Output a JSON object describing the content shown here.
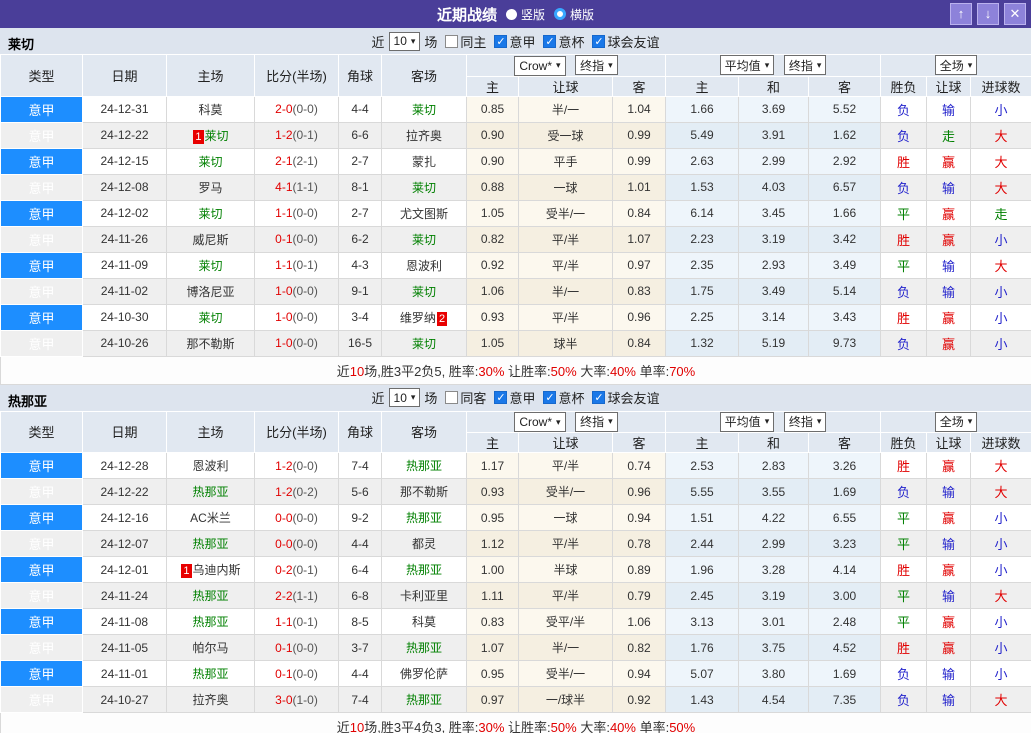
{
  "titlebar": {
    "title": "近期战绩",
    "radio_vertical": "竖版",
    "radio_horizontal": "横版",
    "buttons": {
      "up": "↑",
      "down": "↓",
      "close": "✕"
    }
  },
  "controls": {
    "near": "近",
    "matches": "场"
  },
  "header": {
    "col_type": "类型",
    "col_date": "日期",
    "col_home": "主场",
    "col_score": "比分(半场)",
    "col_corner": "角球",
    "col_away": "客场",
    "crown_select": "Crow*",
    "final_select": "终指",
    "avg_select": "平均值",
    "full_select": "全场",
    "sub_home": "主",
    "sub_handicap": "让球",
    "sub_away": "客",
    "sub_draw": "和",
    "col_result": "胜负",
    "col_asian": "让球",
    "col_goals": "进球数"
  },
  "colors": {
    "titlebar_bg": "#4a3e99",
    "league_cell": "#1d8eff",
    "win_red": "#e10000",
    "draw_green": "#008000",
    "lose_blue": "#2323cc",
    "self_team_green": "#008000",
    "badge_red": "#e80000",
    "checked_blue": "#1a78e8"
  },
  "sections": [
    {
      "team": "莱切",
      "count": "10",
      "filters": [
        {
          "label": "同主",
          "checked": false
        },
        {
          "label": "意甲",
          "checked": true
        },
        {
          "label": "意杯",
          "checked": true
        },
        {
          "label": "球会友谊",
          "checked": true
        }
      ],
      "rows": [
        {
          "lg": "意甲",
          "dt": "24-12-31",
          "hb": "",
          "hm": "科莫",
          "hs": false,
          "ft": "2-0",
          "ht": "(0-0)",
          "cn": "4-4",
          "ab": "",
          "aw": "莱切",
          "as": true,
          "ch": "0.85",
          "cp": "半/一",
          "ca": "1.04",
          "eh": "1.66",
          "ed": "3.69",
          "ea": "5.52",
          "rs": "负",
          "hc": "输",
          "gl": "小"
        },
        {
          "lg": "意甲",
          "dt": "24-12-22",
          "hb": "1",
          "hm": "莱切",
          "hs": true,
          "ft": "1-2",
          "ht": "(0-1)",
          "cn": "6-6",
          "ab": "",
          "aw": "拉齐奥",
          "as": false,
          "ch": "0.90",
          "cp": "受一球",
          "ca": "0.99",
          "eh": "5.49",
          "ed": "3.91",
          "ea": "1.62",
          "rs": "负",
          "hc": "走",
          "gl": "大"
        },
        {
          "lg": "意甲",
          "dt": "24-12-15",
          "hb": "",
          "hm": "莱切",
          "hs": true,
          "ft": "2-1",
          "ht": "(2-1)",
          "cn": "2-7",
          "ab": "",
          "aw": "蒙扎",
          "as": false,
          "ch": "0.90",
          "cp": "平手",
          "ca": "0.99",
          "eh": "2.63",
          "ed": "2.99",
          "ea": "2.92",
          "rs": "胜",
          "hc": "赢",
          "gl": "大"
        },
        {
          "lg": "意甲",
          "dt": "24-12-08",
          "hb": "",
          "hm": "罗马",
          "hs": false,
          "ft": "4-1",
          "ht": "(1-1)",
          "cn": "8-1",
          "ab": "",
          "aw": "莱切",
          "as": true,
          "ch": "0.88",
          "cp": "一球",
          "ca": "1.01",
          "eh": "1.53",
          "ed": "4.03",
          "ea": "6.57",
          "rs": "负",
          "hc": "输",
          "gl": "大"
        },
        {
          "lg": "意甲",
          "dt": "24-12-02",
          "hb": "",
          "hm": "莱切",
          "hs": true,
          "ft": "1-1",
          "ht": "(0-0)",
          "cn": "2-7",
          "ab": "",
          "aw": "尤文图斯",
          "as": false,
          "ch": "1.05",
          "cp": "受半/一",
          "ca": "0.84",
          "eh": "6.14",
          "ed": "3.45",
          "ea": "1.66",
          "rs": "平",
          "hc": "赢",
          "gl": "走"
        },
        {
          "lg": "意甲",
          "dt": "24-11-26",
          "hb": "",
          "hm": "威尼斯",
          "hs": false,
          "ft": "0-1",
          "ht": "(0-0)",
          "cn": "6-2",
          "ab": "",
          "aw": "莱切",
          "as": true,
          "ch": "0.82",
          "cp": "平/半",
          "ca": "1.07",
          "eh": "2.23",
          "ed": "3.19",
          "ea": "3.42",
          "rs": "胜",
          "hc": "赢",
          "gl": "小"
        },
        {
          "lg": "意甲",
          "dt": "24-11-09",
          "hb": "",
          "hm": "莱切",
          "hs": true,
          "ft": "1-1",
          "ht": "(0-1)",
          "cn": "4-3",
          "ab": "",
          "aw": "恩波利",
          "as": false,
          "ch": "0.92",
          "cp": "平/半",
          "ca": "0.97",
          "eh": "2.35",
          "ed": "2.93",
          "ea": "3.49",
          "rs": "平",
          "hc": "输",
          "gl": "大"
        },
        {
          "lg": "意甲",
          "dt": "24-11-02",
          "hb": "",
          "hm": "博洛尼亚",
          "hs": false,
          "ft": "1-0",
          "ht": "(0-0)",
          "cn": "9-1",
          "ab": "",
          "aw": "莱切",
          "as": true,
          "ch": "1.06",
          "cp": "半/一",
          "ca": "0.83",
          "eh": "1.75",
          "ed": "3.49",
          "ea": "5.14",
          "rs": "负",
          "hc": "输",
          "gl": "小"
        },
        {
          "lg": "意甲",
          "dt": "24-10-30",
          "hb": "",
          "hm": "莱切",
          "hs": true,
          "ft": "1-0",
          "ht": "(0-0)",
          "cn": "3-4",
          "ab": "2",
          "aw": "维罗纳",
          "as": false,
          "ch": "0.93",
          "cp": "平/半",
          "ca": "0.96",
          "eh": "2.25",
          "ed": "3.14",
          "ea": "3.43",
          "rs": "胜",
          "hc": "赢",
          "gl": "小"
        },
        {
          "lg": "意甲",
          "dt": "24-10-26",
          "hb": "",
          "hm": "那不勒斯",
          "hs": false,
          "ft": "1-0",
          "ht": "(0-0)",
          "cn": "16-5",
          "ab": "",
          "aw": "莱切",
          "as": true,
          "ch": "1.05",
          "cp": "球半",
          "ca": "0.84",
          "eh": "1.32",
          "ed": "5.19",
          "ea": "9.73",
          "rs": "负",
          "hc": "赢",
          "gl": "小"
        }
      ],
      "summary": [
        {
          "t": "近"
        },
        {
          "t": "10",
          "r": 1
        },
        {
          "t": "场,胜3平2负5, 胜率:"
        },
        {
          "t": "30%",
          "r": 1
        },
        {
          "t": " 让胜率:"
        },
        {
          "t": "50%",
          "r": 1
        },
        {
          "t": " 大率:"
        },
        {
          "t": "40%",
          "r": 1
        },
        {
          "t": " 单率:"
        },
        {
          "t": "70%",
          "r": 1
        }
      ]
    },
    {
      "team": "热那亚",
      "count": "10",
      "filters": [
        {
          "label": "同客",
          "checked": false
        },
        {
          "label": "意甲",
          "checked": true
        },
        {
          "label": "意杯",
          "checked": true
        },
        {
          "label": "球会友谊",
          "checked": true
        }
      ],
      "rows": [
        {
          "lg": "意甲",
          "dt": "24-12-28",
          "hb": "",
          "hm": "恩波利",
          "hs": false,
          "ft": "1-2",
          "ht": "(0-0)",
          "cn": "7-4",
          "ab": "",
          "aw": "热那亚",
          "as": true,
          "ch": "1.17",
          "cp": "平/半",
          "ca": "0.74",
          "eh": "2.53",
          "ed": "2.83",
          "ea": "3.26",
          "rs": "胜",
          "hc": "赢",
          "gl": "大"
        },
        {
          "lg": "意甲",
          "dt": "24-12-22",
          "hb": "",
          "hm": "热那亚",
          "hs": true,
          "ft": "1-2",
          "ht": "(0-2)",
          "cn": "5-6",
          "ab": "",
          "aw": "那不勒斯",
          "as": false,
          "ch": "0.93",
          "cp": "受半/一",
          "ca": "0.96",
          "eh": "5.55",
          "ed": "3.55",
          "ea": "1.69",
          "rs": "负",
          "hc": "输",
          "gl": "大"
        },
        {
          "lg": "意甲",
          "dt": "24-12-16",
          "hb": "",
          "hm": "AC米兰",
          "hs": false,
          "ft": "0-0",
          "ht": "(0-0)",
          "cn": "9-2",
          "ab": "",
          "aw": "热那亚",
          "as": true,
          "ch": "0.95",
          "cp": "一球",
          "ca": "0.94",
          "eh": "1.51",
          "ed": "4.22",
          "ea": "6.55",
          "rs": "平",
          "hc": "赢",
          "gl": "小"
        },
        {
          "lg": "意甲",
          "dt": "24-12-07",
          "hb": "",
          "hm": "热那亚",
          "hs": true,
          "ft": "0-0",
          "ht": "(0-0)",
          "cn": "4-4",
          "ab": "",
          "aw": "都灵",
          "as": false,
          "ch": "1.12",
          "cp": "平/半",
          "ca": "0.78",
          "eh": "2.44",
          "ed": "2.99",
          "ea": "3.23",
          "rs": "平",
          "hc": "输",
          "gl": "小"
        },
        {
          "lg": "意甲",
          "dt": "24-12-01",
          "hb": "1",
          "hm": "乌迪内斯",
          "hs": false,
          "ft": "0-2",
          "ht": "(0-1)",
          "cn": "6-4",
          "ab": "",
          "aw": "热那亚",
          "as": true,
          "ch": "1.00",
          "cp": "半球",
          "ca": "0.89",
          "eh": "1.96",
          "ed": "3.28",
          "ea": "4.14",
          "rs": "胜",
          "hc": "赢",
          "gl": "小"
        },
        {
          "lg": "意甲",
          "dt": "24-11-24",
          "hb": "",
          "hm": "热那亚",
          "hs": true,
          "ft": "2-2",
          "ht": "(1-1)",
          "cn": "6-8",
          "ab": "",
          "aw": "卡利亚里",
          "as": false,
          "ch": "1.11",
          "cp": "平/半",
          "ca": "0.79",
          "eh": "2.45",
          "ed": "3.19",
          "ea": "3.00",
          "rs": "平",
          "hc": "输",
          "gl": "大"
        },
        {
          "lg": "意甲",
          "dt": "24-11-08",
          "hb": "",
          "hm": "热那亚",
          "hs": true,
          "ft": "1-1",
          "ht": "(0-1)",
          "cn": "8-5",
          "ab": "",
          "aw": "科莫",
          "as": false,
          "ch": "0.83",
          "cp": "受平/半",
          "ca": "1.06",
          "eh": "3.13",
          "ed": "3.01",
          "ea": "2.48",
          "rs": "平",
          "hc": "赢",
          "gl": "小"
        },
        {
          "lg": "意甲",
          "dt": "24-11-05",
          "hb": "",
          "hm": "帕尔马",
          "hs": false,
          "ft": "0-1",
          "ht": "(0-0)",
          "cn": "3-7",
          "ab": "",
          "aw": "热那亚",
          "as": true,
          "ch": "1.07",
          "cp": "半/一",
          "ca": "0.82",
          "eh": "1.76",
          "ed": "3.75",
          "ea": "4.52",
          "rs": "胜",
          "hc": "赢",
          "gl": "小"
        },
        {
          "lg": "意甲",
          "dt": "24-11-01",
          "hb": "",
          "hm": "热那亚",
          "hs": true,
          "ft": "0-1",
          "ht": "(0-0)",
          "cn": "4-4",
          "ab": "",
          "aw": "佛罗伦萨",
          "as": false,
          "ch": "0.95",
          "cp": "受半/一",
          "ca": "0.94",
          "eh": "5.07",
          "ed": "3.80",
          "ea": "1.69",
          "rs": "负",
          "hc": "输",
          "gl": "小"
        },
        {
          "lg": "意甲",
          "dt": "24-10-27",
          "hb": "",
          "hm": "拉齐奥",
          "hs": false,
          "ft": "3-0",
          "ht": "(1-0)",
          "cn": "7-4",
          "ab": "",
          "aw": "热那亚",
          "as": true,
          "ch": "0.97",
          "cp": "一/球半",
          "ca": "0.92",
          "eh": "1.43",
          "ed": "4.54",
          "ea": "7.35",
          "rs": "负",
          "hc": "输",
          "gl": "大"
        }
      ],
      "summary": [
        {
          "t": "近"
        },
        {
          "t": "10",
          "r": 1
        },
        {
          "t": "场,胜3平4负3, 胜率:"
        },
        {
          "t": "30%",
          "r": 1
        },
        {
          "t": " 让胜率:"
        },
        {
          "t": "50%",
          "r": 1
        },
        {
          "t": " 大率:"
        },
        {
          "t": "40%",
          "r": 1
        },
        {
          "t": " 单率:"
        },
        {
          "t": "50%",
          "r": 1
        }
      ]
    }
  ]
}
